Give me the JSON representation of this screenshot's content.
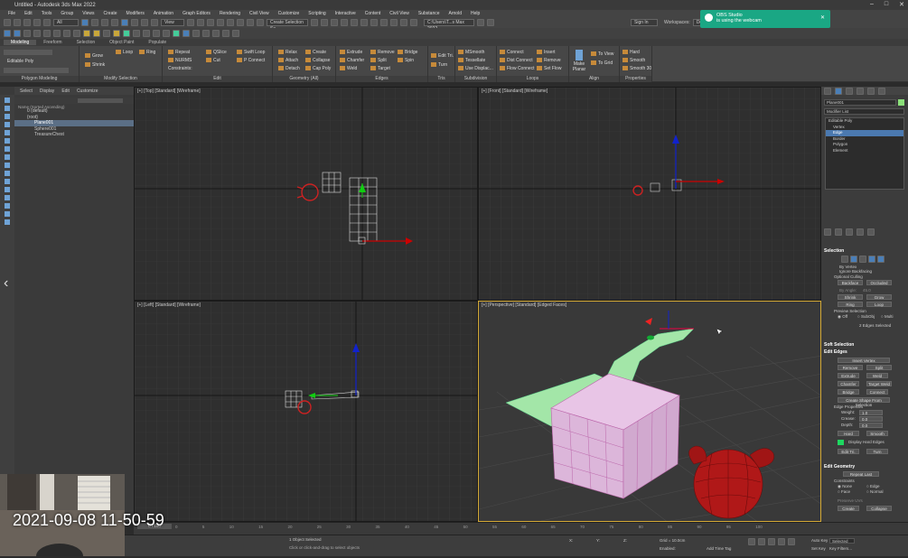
{
  "window": {
    "title": "Untitled - Autodesk 3ds Max 2022"
  },
  "menu": [
    "File",
    "Edit",
    "Tools",
    "Group",
    "Views",
    "Create",
    "Modifiers",
    "Animation",
    "Graph Editors",
    "Rendering",
    "Civil View",
    "Customize",
    "Scripting",
    "Interactive",
    "Content",
    "Civil View",
    "Substance",
    "Arnold",
    "Help"
  ],
  "toolbar": {
    "selection_filter": "All",
    "view_dropdown": "View",
    "selection_set": "Create Selection Se",
    "workspace_path": "C:\\Users\\T...s Max 2022",
    "workspaces_label": "Workspaces:",
    "workspace_value": "Default",
    "sign_in": "Sign In"
  },
  "ribbon_tabs": [
    "Modeling",
    "Freeform",
    "Selection",
    "Object Paint",
    "Populate"
  ],
  "ribbon": {
    "poly_label": "Editable Poly",
    "groups": [
      "Polygon Modeling",
      "Modify Selection",
      "Edit",
      "Geometry (All)",
      "Edges",
      "Tris",
      "Subdivision",
      "Loops",
      "Align",
      "Properties"
    ],
    "modify_sel": [
      "Grow",
      "Shrink",
      "Loop",
      "Ring"
    ],
    "edit": [
      "Repeat",
      "QSlice",
      "Swift Loop",
      "NURMS",
      "Cut",
      "P Connect",
      "Constraints:"
    ],
    "geometry": [
      "Relax",
      "Create",
      "Attach",
      "Collapse",
      "Detach",
      "Cap Poly"
    ],
    "edges": [
      "Extrude",
      "Remove",
      "Bridge",
      "Chamfer",
      "Split",
      "Spin",
      "Weld",
      "Target"
    ],
    "tris": [
      "Edit Tri.",
      "Turn"
    ],
    "subdivision": [
      "MSmooth",
      "Tessellate",
      "Use Displac..."
    ],
    "loops": [
      "Connect",
      "Insert",
      "Dist Connect",
      "Remove",
      "Flow Connect",
      "Set Flow"
    ],
    "align": [
      "Make Planar",
      "To View",
      "To Grid"
    ],
    "properties": [
      "Hard",
      "Smooth",
      "Smooth 30"
    ]
  },
  "scene_explorer": {
    "tabs": [
      "Select",
      "Display",
      "Edit",
      "Customize"
    ],
    "header": "Name (Sorted Ascending)",
    "rows": [
      "0 (default)",
      "{root}",
      "Plane001",
      "Sphere001",
      "TreasureChest"
    ]
  },
  "viewports": {
    "top": "[+] [Top] [Standard] [Wireframe]",
    "front": "[+] [Front] [Standard] [Wireframe]",
    "left": "[+] [Left] [Standard] [Wireframe]",
    "persp": "[+] [Perspective] [Standard] [Edged Faces]"
  },
  "command_panel": {
    "object_name": "Plane001",
    "modifier_list": "Modifier List",
    "stack": [
      "Editable Poly",
      "Vertex",
      "Edge",
      "Border",
      "Polygon",
      "Element"
    ],
    "selection_title": "Selection",
    "by_vertex": "By Vertex",
    "ignore_backfacing": "Ignore Backfacing",
    "by_angle": "By Angle:",
    "by_angle_val": "45.0",
    "optional_culling": "Optional Culling",
    "backface": "Backface",
    "occluded": "Occluded",
    "shrink": "Shrink",
    "grow": "Grow",
    "ring": "Ring",
    "loop": "Loop",
    "preview_sel": "Preview Selection",
    "preview_opts": [
      "Off",
      "SubObj",
      "Multi"
    ],
    "edges_selected": "2 Edges Selected",
    "soft_sel": "Soft Selection",
    "edit_edges": "Edit Edges",
    "insert_vertex": "Insert Vertex",
    "remove": "Remove",
    "split": "Split",
    "extrude": "Extrude",
    "weld": "Weld",
    "chamfer": "Chamfer",
    "target_weld": "Target Weld",
    "bridge": "Bridge",
    "connect": "Connect",
    "create_shape": "Create Shape From Selection",
    "edge_props": "Edge Properties",
    "weight": "Weight:",
    "weight_val": "1.0",
    "crease": "Crease:",
    "crease_val": "0.0",
    "depth": "Depth:",
    "depth_val": "0.0",
    "hard": "Hard",
    "smooth": "Smooth",
    "display_hard": "Display Hard Edges",
    "edit_tri": "Edit Tri.",
    "turn": "Turn",
    "edit_geom": "Edit Geometry",
    "repeat_last": "Repeat Last",
    "constraints": "Constraints",
    "constraint_opts": [
      "None",
      "Edge",
      "Face",
      "Normal"
    ],
    "preserve_uvs": "Preserve UVs",
    "create": "Create",
    "collapse": "Collapse"
  },
  "status": {
    "selected": "1 Object Selected",
    "hint": "Click or click-and-drag to select objects",
    "frame": "0 / 100",
    "grid": "Grid = 10.0cm",
    "add_time_tag": "Add Time Tag",
    "selected_label": "Selected",
    "autokey": "Auto Key",
    "setkey": "Set Key",
    "key_filters": "Key Filters...",
    "x": "X:",
    "y": "Y:",
    "z": "Z:",
    "enabled": "Enabled:"
  },
  "timeline_ticks": [
    "0",
    "5",
    "10",
    "15",
    "20",
    "25",
    "30",
    "35",
    "40",
    "45",
    "50",
    "55",
    "60",
    "65",
    "70",
    "75",
    "80",
    "85",
    "90",
    "95",
    "100"
  ],
  "obs": {
    "title": "OBS Studio",
    "msg": "is using the webcam"
  },
  "overlay_time": "2021-09-08 11-50-59",
  "colors": {
    "accent": "#1aa784",
    "selected_green": "#a3e6a8",
    "box_pink": "#e8c5e6",
    "sphere_red": "#b01818",
    "viewport_active": "#d4a935"
  }
}
